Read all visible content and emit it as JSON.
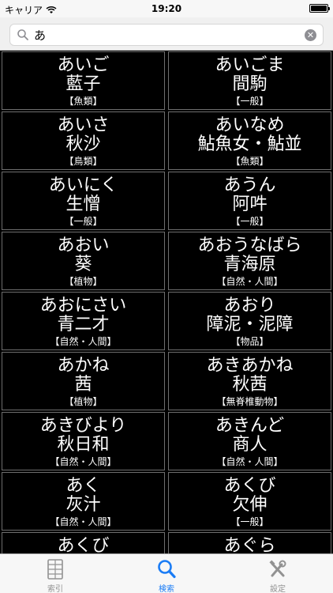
{
  "status_bar": {
    "carrier": "キャリア",
    "time": "19:20"
  },
  "search": {
    "value": "あ",
    "placeholder": ""
  },
  "entries": [
    {
      "reading": "あいご",
      "kanji": "藍子",
      "category": "【魚類】"
    },
    {
      "reading": "あいごま",
      "kanji": "間駒",
      "category": "【一般】"
    },
    {
      "reading": "あいさ",
      "kanji": "秋沙",
      "category": "【鳥類】"
    },
    {
      "reading": "あいなめ",
      "kanji": "鮎魚女・鮎並",
      "category": "【魚類】"
    },
    {
      "reading": "あいにく",
      "kanji": "生憎",
      "category": "【一般】"
    },
    {
      "reading": "あうん",
      "kanji": "阿吽",
      "category": "【一般】"
    },
    {
      "reading": "あおい",
      "kanji": "葵",
      "category": "【植物】"
    },
    {
      "reading": "あおうなばら",
      "kanji": "青海原",
      "category": "【自然・人間】"
    },
    {
      "reading": "あおにさい",
      "kanji": "青二才",
      "category": "【自然・人間】"
    },
    {
      "reading": "あおり",
      "kanji": "障泥・泥障",
      "category": "【物品】"
    },
    {
      "reading": "あかね",
      "kanji": "茜",
      "category": "【植物】"
    },
    {
      "reading": "あきあかね",
      "kanji": "秋茜",
      "category": "【無脊椎動物】"
    },
    {
      "reading": "あきびより",
      "kanji": "秋日和",
      "category": "【自然・人間】"
    },
    {
      "reading": "あきんど",
      "kanji": "商人",
      "category": "【自然・人間】"
    },
    {
      "reading": "あく",
      "kanji": "灰汁",
      "category": "【自然・人間】"
    },
    {
      "reading": "あくび",
      "kanji": "欠伸",
      "category": "【一般】"
    },
    {
      "reading": "あくび",
      "kanji": "",
      "category": ""
    },
    {
      "reading": "あぐら",
      "kanji": "",
      "category": ""
    }
  ],
  "tab_bar": {
    "tabs": [
      {
        "label": "索引",
        "icon": "index-icon",
        "active": false
      },
      {
        "label": "検索",
        "icon": "search-icon",
        "active": true
      },
      {
        "label": "設定",
        "icon": "settings-icon",
        "active": false
      }
    ],
    "active_color": "#1a7cf5",
    "inactive_color": "#929292"
  }
}
